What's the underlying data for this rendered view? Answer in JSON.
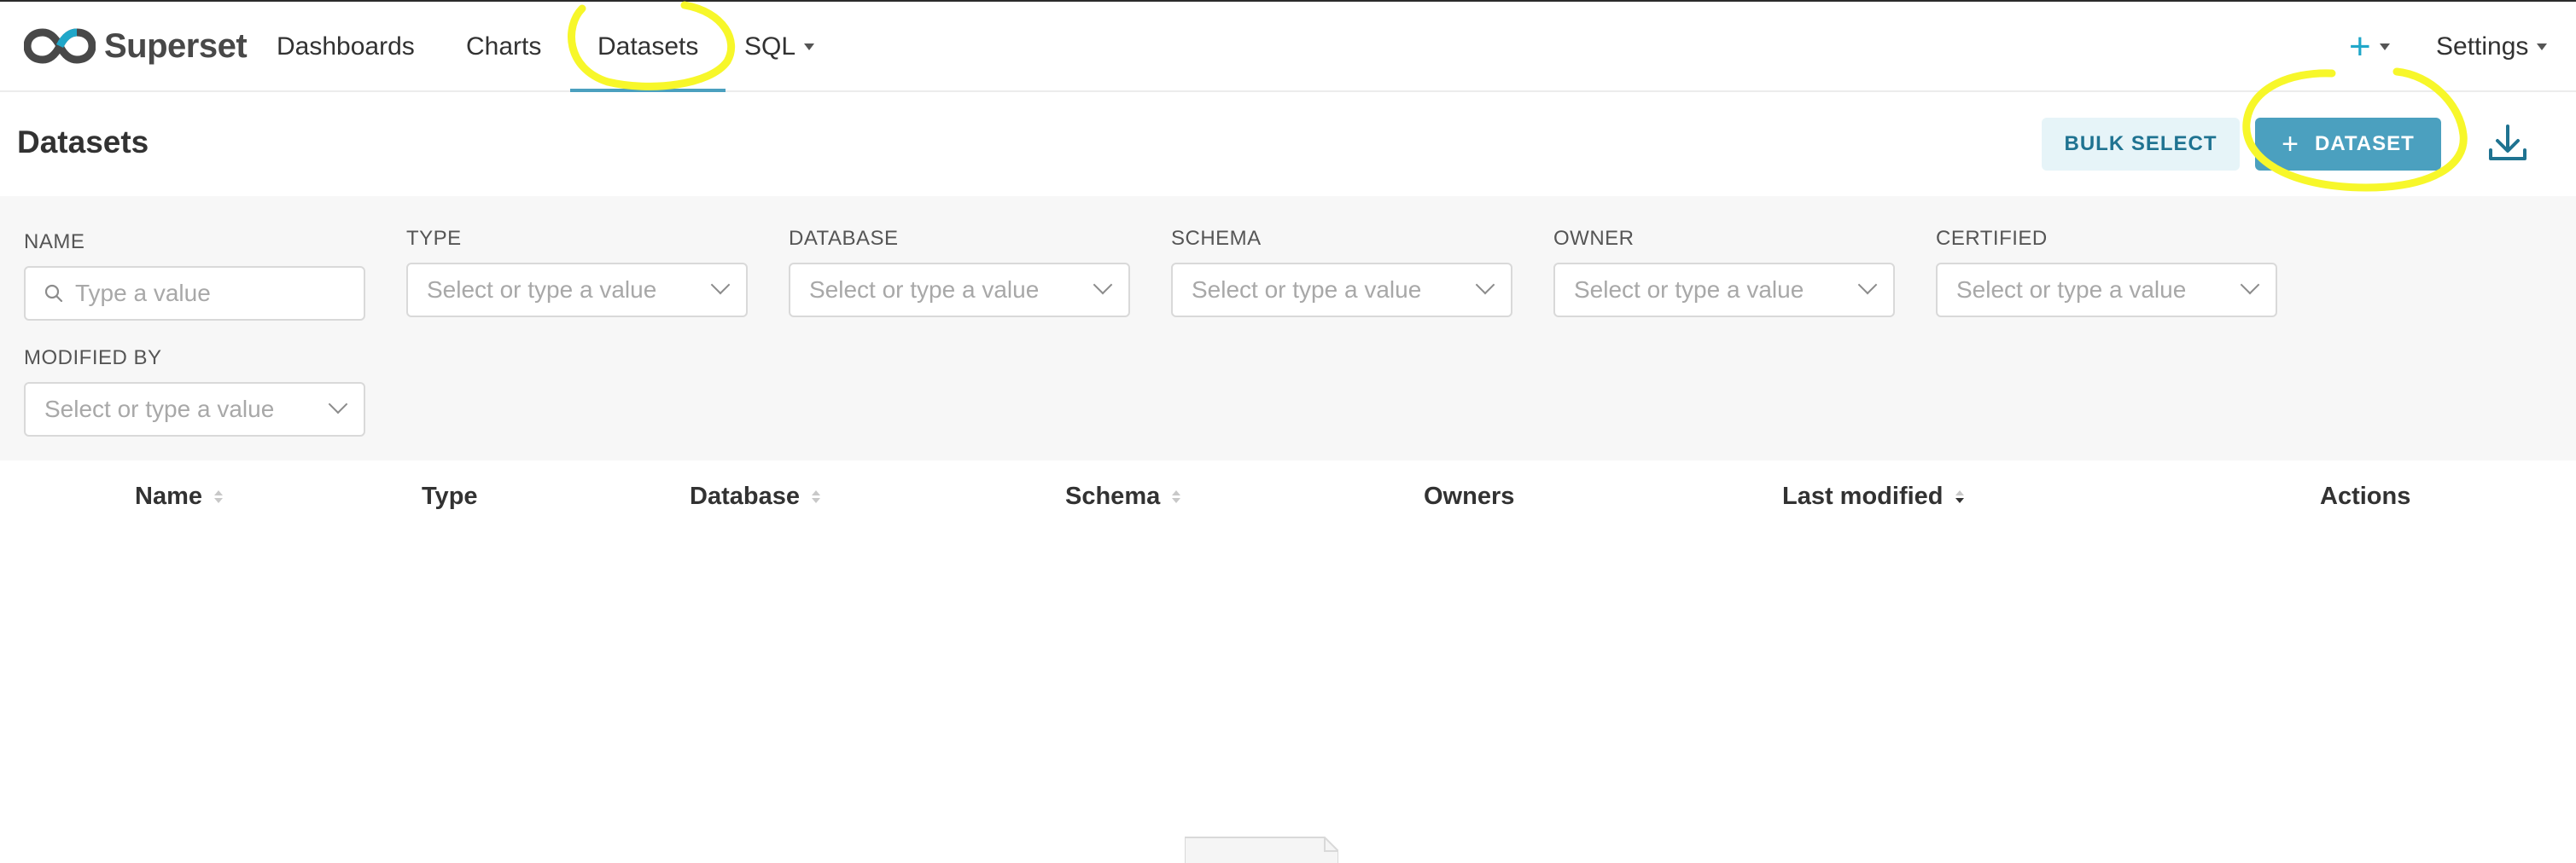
{
  "app": {
    "name": "Superset",
    "accent_color": "#4ba0bf",
    "annotation_color": "#f7f72a"
  },
  "nav": {
    "items": [
      {
        "label": "Dashboards",
        "active": false
      },
      {
        "label": "Charts",
        "active": false
      },
      {
        "label": "Datasets",
        "active": true
      },
      {
        "label": "SQL",
        "active": false,
        "has_dropdown": true
      }
    ],
    "plus_label": "+",
    "settings_label": "Settings"
  },
  "header": {
    "title": "Datasets",
    "bulk_select_label": "BULK SELECT",
    "add_dataset_label": "DATASET",
    "add_dataset_icon": "+",
    "download_icon": "download-icon"
  },
  "filters": [
    {
      "label": "NAME",
      "placeholder": "Type a value",
      "kind": "search"
    },
    {
      "label": "TYPE",
      "placeholder": "Select or type a value",
      "kind": "select"
    },
    {
      "label": "DATABASE",
      "placeholder": "Select or type a value",
      "kind": "select"
    },
    {
      "label": "SCHEMA",
      "placeholder": "Select or type a value",
      "kind": "select"
    },
    {
      "label": "OWNER",
      "placeholder": "Select or type a value",
      "kind": "select"
    },
    {
      "label": "CERTIFIED",
      "placeholder": "Select or type a value",
      "kind": "select"
    },
    {
      "label": "MODIFIED BY",
      "placeholder": "Select or type a value",
      "kind": "select"
    }
  ],
  "table": {
    "columns": [
      {
        "label": "Name",
        "sortable": true
      },
      {
        "label": "Type",
        "sortable": false
      },
      {
        "label": "Database",
        "sortable": true
      },
      {
        "label": "Schema",
        "sortable": true
      },
      {
        "label": "Owners",
        "sortable": false
      },
      {
        "label": "Last modified",
        "sortable": true,
        "sorted": "desc"
      },
      {
        "label": "Actions",
        "sortable": false
      }
    ],
    "rows": []
  }
}
